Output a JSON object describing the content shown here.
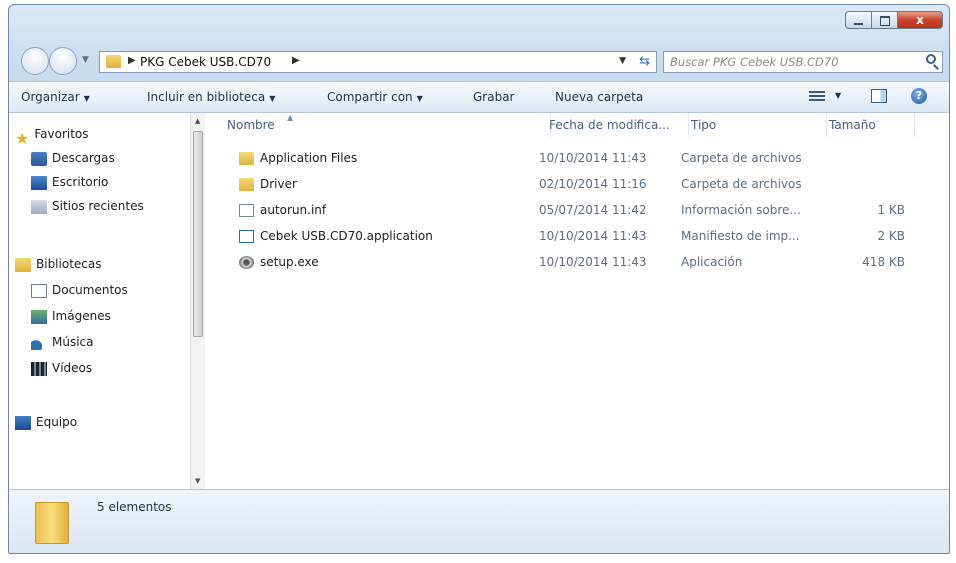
{
  "window": {
    "close_glyph": "x"
  },
  "address": {
    "path": "PKG Cebek USB.CD70",
    "search_placeholder": "Buscar PKG Cebek USB.CD70"
  },
  "toolbar": {
    "organize": "Organizar",
    "include_library": "Incluir en biblioteca",
    "share": "Compartir con",
    "burn": "Grabar",
    "new_folder": "Nueva carpeta"
  },
  "nav": {
    "favorites": "Favoritos",
    "downloads": "Descargas",
    "desktop": "Escritorio",
    "recent": "Sitios recientes",
    "libraries": "Bibliotecas",
    "documents": "Documentos",
    "images": "Imágenes",
    "music": "Música",
    "videos": "Vídeos",
    "computer": "Equipo"
  },
  "columns": {
    "name": "Nombre",
    "date": "Fecha de modifica...",
    "type": "Tipo",
    "size": "Tamaño"
  },
  "files": [
    {
      "name": "Application Files",
      "date": "10/10/2014 11:43",
      "type": "Carpeta de archivos",
      "size": "",
      "icon": "folder-icon"
    },
    {
      "name": "Driver",
      "date": "02/10/2014 11:16",
      "type": "Carpeta de archivos",
      "size": "",
      "icon": "folder-icon"
    },
    {
      "name": "autorun.inf",
      "date": "05/07/2014 11:42",
      "type": "Información sobre...",
      "size": "1 KB",
      "icon": "inf-file-icon"
    },
    {
      "name": "Cebek USB.CD70.application",
      "date": "10/10/2014 11:43",
      "type": "Manifiesto de imp...",
      "size": "2 KB",
      "icon": "application-manifest-icon"
    },
    {
      "name": "setup.exe",
      "date": "10/10/2014 11:43",
      "type": "Aplicación",
      "size": "418 KB",
      "icon": "setup-exe-icon"
    }
  ],
  "status": {
    "count": "5 elementos"
  }
}
